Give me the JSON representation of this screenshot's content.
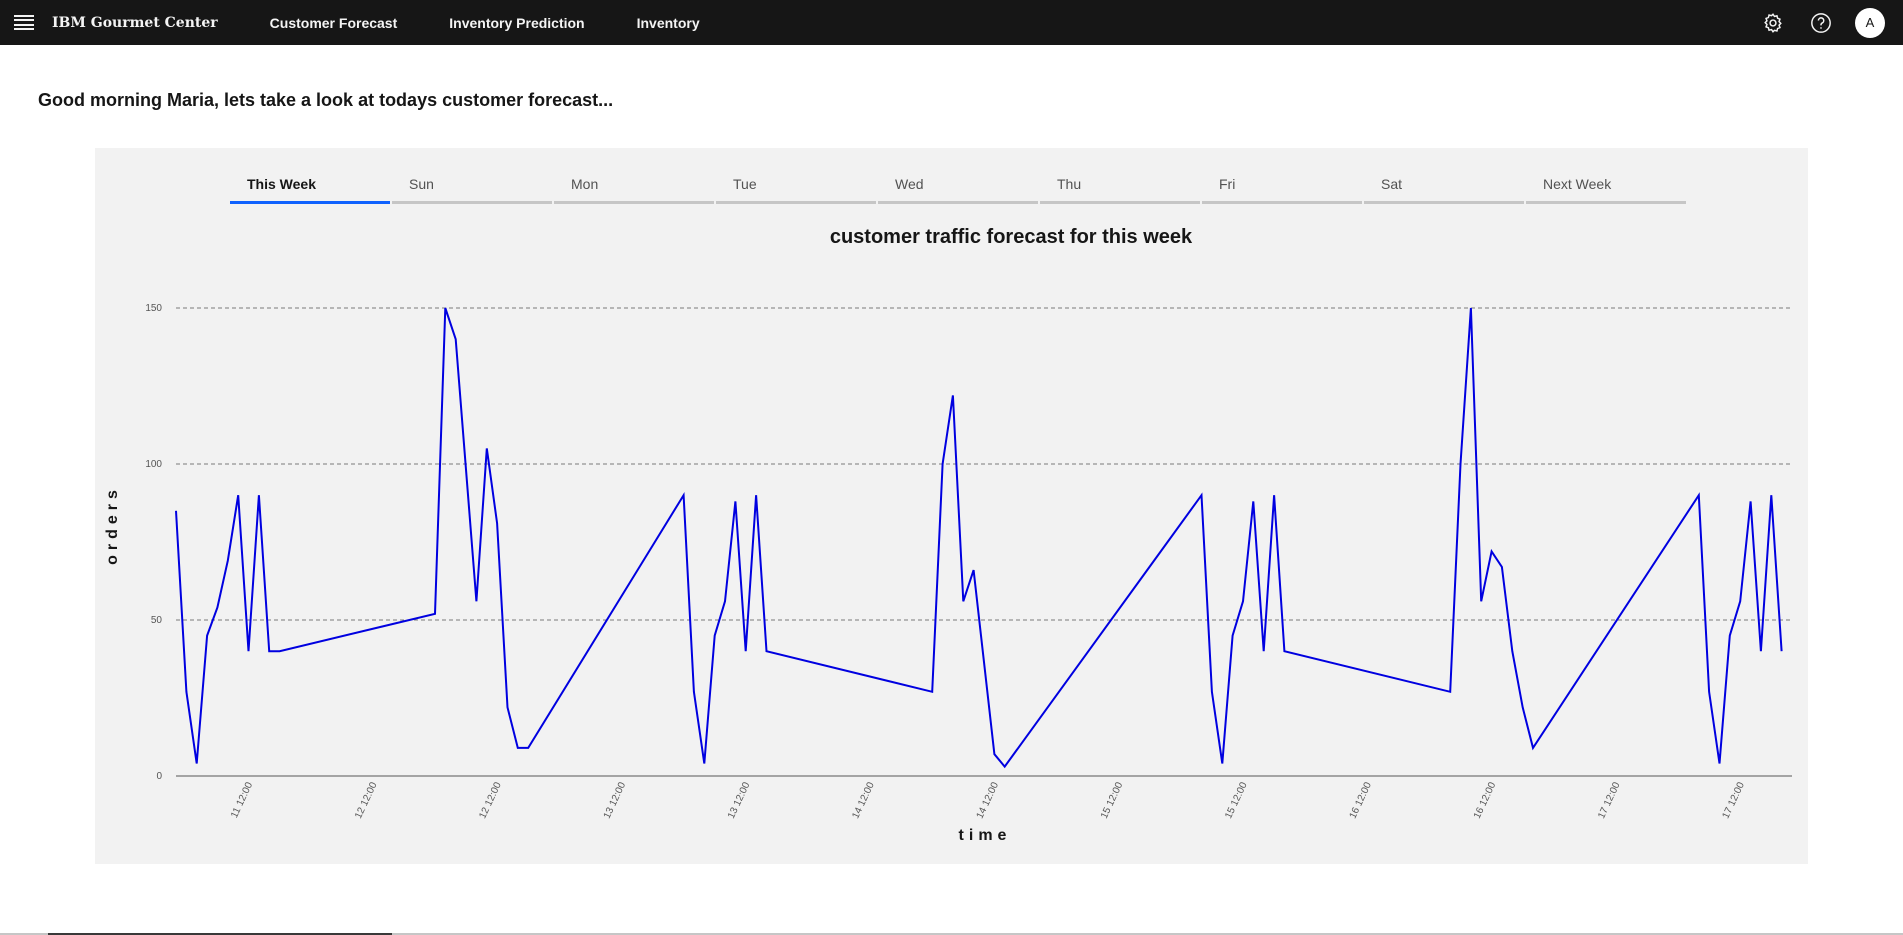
{
  "header": {
    "brand": "IBM Gourmet Center",
    "nav": [
      "Customer Forecast",
      "Inventory Prediction",
      "Inventory"
    ],
    "avatar_initial": "A",
    "icons": [
      "menu-icon",
      "settings-icon",
      "help-icon"
    ]
  },
  "greeting": "Good morning Maria, lets take a look at todays customer forecast...",
  "tabs": [
    {
      "label": "This Week",
      "active": true
    },
    {
      "label": "Sun",
      "active": false
    },
    {
      "label": "Mon",
      "active": false
    },
    {
      "label": "Tue",
      "active": false
    },
    {
      "label": "Wed",
      "active": false
    },
    {
      "label": "Thu",
      "active": false
    },
    {
      "label": "Fri",
      "active": false
    },
    {
      "label": "Sat",
      "active": false
    },
    {
      "label": "Next Week",
      "active": false
    }
  ],
  "colors": {
    "line": "#0000e0",
    "accent": "#0f62fe",
    "nav_bg": "#161616",
    "panel_bg": "#f2f2f2"
  },
  "chart_data": {
    "type": "line",
    "title": "customer traffic forecast for this week",
    "xlabel": "time",
    "ylabel": "orders",
    "ylim": [
      0,
      150
    ],
    "yticks": [
      0,
      50,
      100,
      150
    ],
    "grid": "horizontal dashed",
    "xlim_hours": [
      5,
      161
    ],
    "xtick_hours": [
      12,
      24,
      36,
      48,
      60,
      72,
      84,
      96,
      108,
      120,
      132,
      144,
      156
    ],
    "xtick_labels": [
      "11 12:00",
      "12 12:00",
      "12 12:00",
      "13 12:00",
      "13 12:00",
      "14 12:00",
      "14 12:00",
      "15 12:00",
      "15 12:00",
      "16 12:00",
      "16 12:00",
      "17 12:00",
      "17 12:00"
    ],
    "series": [
      {
        "x": [
          5,
          6,
          7,
          8,
          9,
          10,
          11,
          12,
          13,
          14,
          15,
          30,
          31,
          32,
          34,
          35,
          36,
          37,
          38,
          39,
          54,
          55,
          56,
          57,
          58,
          59,
          60,
          61,
          62,
          78,
          79,
          80,
          81,
          82,
          84,
          85,
          104,
          105,
          106,
          107,
          108,
          109,
          110,
          111,
          112,
          128,
          129,
          130,
          131,
          132,
          133,
          134,
          135,
          136,
          152,
          153,
          154,
          155,
          156,
          157,
          158,
          159,
          160
        ],
        "y": [
          85,
          27,
          4,
          45,
          54,
          69,
          90,
          40,
          90,
          40,
          40,
          52,
          150,
          140,
          56,
          105,
          81,
          22,
          9,
          9,
          90,
          27,
          4,
          45,
          56,
          88,
          40,
          90,
          40,
          27,
          100,
          122,
          56,
          66,
          7,
          3,
          90,
          27,
          4,
          45,
          56,
          88,
          40,
          90,
          40,
          27,
          100,
          150,
          56,
          72,
          67,
          40,
          22,
          9,
          90,
          27,
          4,
          45,
          56,
          88,
          40,
          90,
          40
        ]
      }
    ]
  }
}
